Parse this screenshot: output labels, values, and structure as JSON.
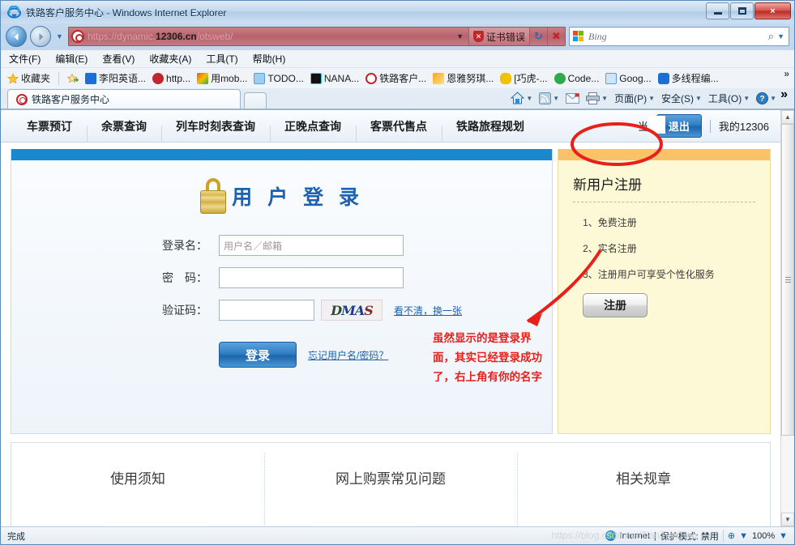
{
  "window": {
    "title": "铁路客户服务中心 - Windows Internet Explorer",
    "icon": "ie-icon",
    "minimize_label": "最小化",
    "maximize_label": "最大化",
    "close_label": "×"
  },
  "navbar": {
    "back_label": "◀",
    "forward_label": "▶",
    "recent_pages_label": "▼",
    "address": {
      "prefix": "https://dynamic.",
      "host": "12306.cn",
      "suffix": "/otsweb/",
      "favicon": "12306-icon",
      "dropdown_label": "▼"
    },
    "cert_error_label": "证书错误",
    "cert_error_icon": "shield-error-icon",
    "refresh_label": "↻",
    "stop_label": "✖",
    "search": {
      "placeholder": "Bing",
      "icon": "bing-logo-icon",
      "go_icon": "search-icon",
      "dropdown_label": "▼"
    }
  },
  "menubar": {
    "items": [
      {
        "text": "文件(F)",
        "name": "menu-file"
      },
      {
        "text": "编辑(E)",
        "name": "menu-edit"
      },
      {
        "text": "查看(V)",
        "name": "menu-view"
      },
      {
        "text": "收藏夹(A)",
        "name": "menu-favorites"
      },
      {
        "text": "工具(T)",
        "name": "menu-tools"
      },
      {
        "text": "帮助(H)",
        "name": "menu-help"
      }
    ]
  },
  "favoritesbar": {
    "favorites_label": "收藏夹",
    "favorites_icon": "star-icon",
    "add_icon": "add-to-favorites-icon",
    "overflow_label": "»",
    "items": [
      {
        "label": "李阳英语...",
        "icon_color": "#1b6fd6",
        "name": "favorite-liyang-english"
      },
      {
        "label": "http...",
        "icon_color": "#c0272d",
        "name": "favorite-http"
      },
      {
        "label": "用mob...",
        "icon_color": "#e8501f",
        "name": "favorite-yongmob"
      },
      {
        "label": "TODO...",
        "icon_color": "#4da3e8",
        "name": "favorite-todo"
      },
      {
        "label": "NANA...",
        "icon_color": "#111111",
        "name": "favorite-nana"
      },
      {
        "label": "铁路客户...",
        "icon_color": "#c0272d",
        "name": "favorite-railway-customer"
      },
      {
        "label": "恩雅努琪...",
        "icon_color": "#f5a623",
        "name": "favorite-enya"
      },
      {
        "label": "[巧虎-...",
        "icon_color": "#f2c200",
        "name": "favorite-qiaohu"
      },
      {
        "label": "Code...",
        "icon_color": "#2faa4a",
        "name": "favorite-code"
      },
      {
        "label": "Goog...",
        "icon_color": "#4da3e8",
        "name": "favorite-google"
      },
      {
        "label": "多线程编...",
        "icon_color": "#1b6fd6",
        "name": "favorite-multithread"
      }
    ]
  },
  "tabstrip": {
    "tab_title": "铁路客户服务中心",
    "tab_favicon": "12306-icon",
    "new_tab_label": "",
    "commands": [
      {
        "label": "",
        "icon": "home-icon",
        "name": "command-home",
        "caret": "▼"
      },
      {
        "label": "",
        "icon": "feeds-icon",
        "name": "command-feeds",
        "caret": "▼"
      },
      {
        "label": "",
        "icon": "mail-icon",
        "name": "command-mail",
        "caret": ""
      },
      {
        "label": "",
        "icon": "print-icon",
        "name": "command-print",
        "caret": "▼"
      },
      {
        "label": "页面(P)",
        "icon": "",
        "name": "command-page",
        "caret": "▼"
      },
      {
        "label": "安全(S)",
        "icon": "",
        "name": "command-safety",
        "caret": "▼"
      },
      {
        "label": "工具(O)",
        "icon": "",
        "name": "command-tools",
        "caret": "▼"
      },
      {
        "label": "",
        "icon": "help-icon",
        "name": "command-help",
        "caret": "▼"
      }
    ],
    "overflow_label": "»"
  },
  "site": {
    "nav_items": [
      {
        "label": "车票预订",
        "name": "site-nav-ticket-booking"
      },
      {
        "label": "余票查询",
        "name": "site-nav-remaining-tickets"
      },
      {
        "label": "列车时刻表查询",
        "name": "site-nav-timetable"
      },
      {
        "label": "正晚点查询",
        "name": "site-nav-punctuality"
      },
      {
        "label": "客票代售点",
        "name": "site-nav-agencies"
      },
      {
        "label": "铁路旅程规划",
        "name": "site-nav-journey-planner"
      }
    ],
    "user": {
      "name": "当",
      "logout_label": "退出",
      "separator": "|",
      "my_account_label": "我的12306"
    },
    "login": {
      "title": "用 户 登 录",
      "lock_icon": "lock-icon",
      "fields": [
        {
          "label": "登录名：",
          "value": "",
          "placeholder": "用户名／邮箱",
          "name": "login-name-input"
        },
        {
          "label": "密　码：",
          "value": "",
          "placeholder": "",
          "name": "password-input"
        },
        {
          "label": "验证码：",
          "value": "",
          "placeholder": "",
          "name": "captcha-input"
        }
      ],
      "captcha_text": [
        "D",
        "MA",
        "S"
      ],
      "captcha_refresh_label": "看不清，换一张",
      "submit_label": "登录",
      "forgot_label": "忘记用户名/密码？"
    },
    "register": {
      "title": "新用户注册",
      "items": [
        "1、免费注册",
        "2、实名注册",
        "3、注册用户可享受个性化服务"
      ],
      "button_label": "注册"
    },
    "bottom_columns": [
      {
        "title": "使用须知",
        "name": "bottom-column-usage-notice"
      },
      {
        "title": "网上购票常见问题",
        "name": "bottom-column-faq"
      },
      {
        "title": "相关规章",
        "name": "bottom-column-regulations"
      }
    ]
  },
  "annotation": {
    "lines": [
      "虽然显示的是登录界",
      "面，其实已经登录成功",
      "了，右上角有你的名字"
    ],
    "color": "#e8201a",
    "arrow": "red-arrow",
    "ellipse": "red-ellipse-highlight"
  },
  "statusbar": {
    "status_text": "完成",
    "zone_icon": "internet-zone-icon",
    "zone_text": "Internet",
    "separator": "|",
    "protected_mode_text": "保护模式: 禁用",
    "zoom_level": "100%",
    "zoom_caret": "▼",
    "watermark": "https://blog.csdn.net/TianTianTiao"
  },
  "scrollbar": {
    "up_label": "▲",
    "down_label": "▼"
  }
}
